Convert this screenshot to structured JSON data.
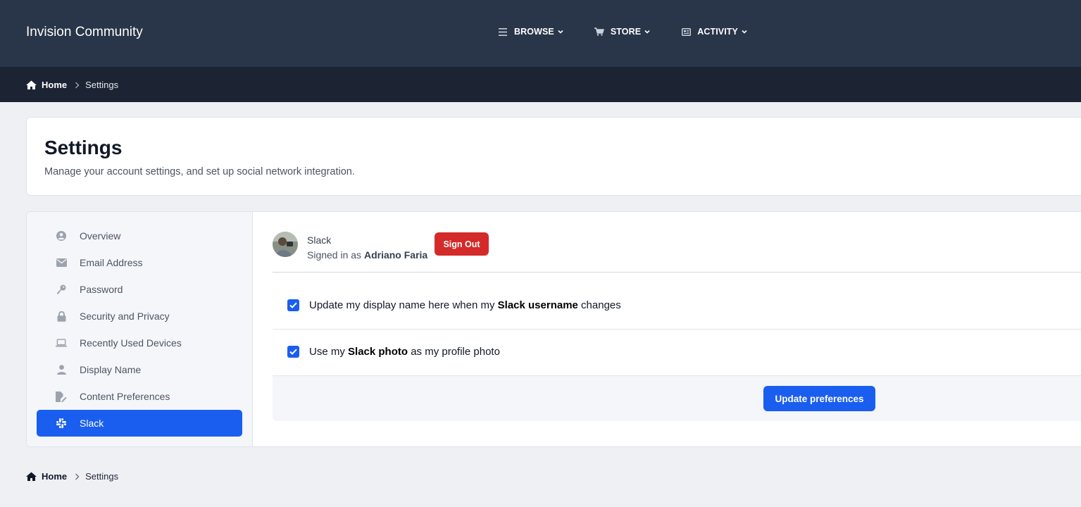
{
  "brand": "Invision Community",
  "nav": {
    "browse": "BROWSE",
    "store": "STORE",
    "activity": "ACTIVITY"
  },
  "breadcrumb": {
    "home": "Home",
    "current": "Settings"
  },
  "header": {
    "title": "Settings",
    "description": "Manage your account settings, and set up social network integration."
  },
  "sidebar": {
    "items": [
      {
        "label": "Overview",
        "icon": "user-circle-icon"
      },
      {
        "label": "Email Address",
        "icon": "envelope-icon"
      },
      {
        "label": "Password",
        "icon": "key-icon"
      },
      {
        "label": "Security and Privacy",
        "icon": "lock-icon"
      },
      {
        "label": "Recently Used Devices",
        "icon": "laptop-icon"
      },
      {
        "label": "Display Name",
        "icon": "user-icon"
      },
      {
        "label": "Content Preferences",
        "icon": "file-edit-icon"
      },
      {
        "label": "Slack",
        "icon": "slack-icon",
        "active": true
      }
    ]
  },
  "account": {
    "service": "Slack",
    "signed_in_prefix": "Signed in as",
    "user_name": "Adriano Faria",
    "sign_out": "Sign Out"
  },
  "preferences": {
    "pref1": {
      "before": "Update my display name here when my ",
      "bold": "Slack username",
      "after": " changes",
      "checked": true
    },
    "pref2": {
      "before": "Use my ",
      "bold": "Slack photo",
      "after": " as my profile photo",
      "checked": true
    },
    "update_button": "Update preferences"
  },
  "colors": {
    "topbar": "#293548",
    "breadcrumb_bar": "#1c2434",
    "accent": "#1a5ef0",
    "danger": "#d42a2a"
  }
}
